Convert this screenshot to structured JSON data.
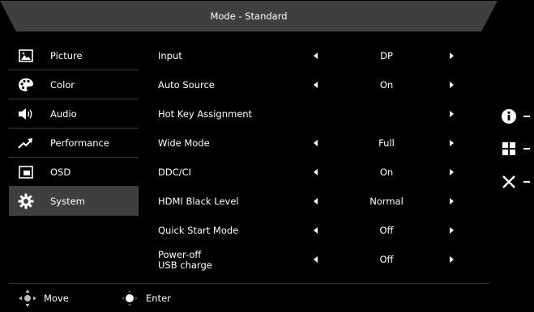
{
  "header": {
    "title": "Mode - Standard"
  },
  "sidebar": {
    "items": [
      {
        "label": "Picture",
        "icon": "picture-icon"
      },
      {
        "label": "Color",
        "icon": "palette-icon"
      },
      {
        "label": "Audio",
        "icon": "speaker-icon"
      },
      {
        "label": "Performance",
        "icon": "trend-up-icon"
      },
      {
        "label": "OSD",
        "icon": "osd-icon"
      },
      {
        "label": "System",
        "icon": "gear-icon",
        "active": true
      }
    ]
  },
  "settings": [
    {
      "label": "Input",
      "value": "DP"
    },
    {
      "label": "Auto Source",
      "value": "On"
    },
    {
      "label": "Hot Key Assignment",
      "value": ""
    },
    {
      "label": "Wide Mode",
      "value": "Full"
    },
    {
      "label": "DDC/CI",
      "value": "On"
    },
    {
      "label": "HDMI Black Level",
      "value": "Normal"
    },
    {
      "label": "Quick Start Mode",
      "value": "Off"
    },
    {
      "label_line1": "Power-off",
      "label_line2": "USB charge",
      "value": "Off"
    }
  ],
  "footer": {
    "move_label": "Move",
    "enter_label": "Enter"
  },
  "side_buttons": [
    {
      "icon": "info-icon"
    },
    {
      "icon": "menu-grid-icon"
    },
    {
      "icon": "close-icon"
    }
  ]
}
